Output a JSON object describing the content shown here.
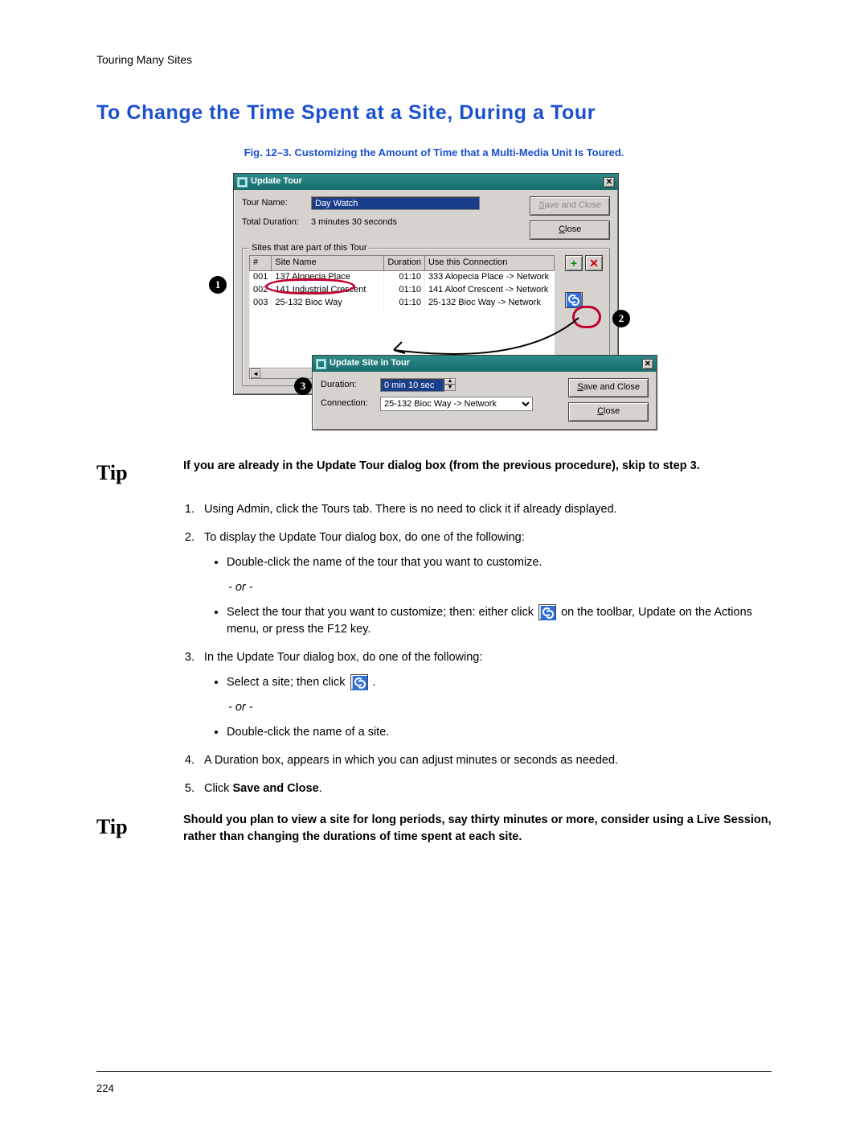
{
  "running_head": "Touring Many Sites",
  "heading": "To Change the Time Spent at a Site, During a Tour",
  "fig_caption": "Fig. 12–3.   Customizing the Amount of Time that a Multi-Media Unit Is Toured.",
  "update_tour": {
    "title": "Update Tour",
    "tour_name_label": "Tour Name:",
    "tour_name_value": "Day Watch",
    "total_duration_label": "Total Duration:",
    "total_duration_value": "3 minutes 30 seconds",
    "save_close": "Save and Close",
    "close": "Close",
    "group_label": "Sites that are part of this Tour",
    "columns": {
      "num": "#",
      "site": "Site Name",
      "dur": "Duration",
      "conn": "Use this Connection"
    },
    "rows": [
      {
        "num": "001",
        "site": "137 Alopecia Place",
        "dur": "01:10",
        "conn": "333 Alopecia Place -> Network"
      },
      {
        "num": "002",
        "site": "141 Industrial Crescent",
        "dur": "01:10",
        "conn": "141 Aloof Crescent -> Network"
      },
      {
        "num": "003",
        "site": "25-132 Bioc Way",
        "dur": "01:10",
        "conn": "25-132 Bioc Way -> Network"
      }
    ]
  },
  "update_site": {
    "title": "Update Site in Tour",
    "duration_label": "Duration:",
    "duration_value": "0 min 10 sec",
    "connection_label": "Connection:",
    "connection_value": "25-132 Bioc Way -> Network",
    "save_close": "Save and Close",
    "close": "Close"
  },
  "annotations": {
    "n1": "1",
    "n2": "2",
    "n3": "3"
  },
  "tip1_label": "Tip",
  "tip1_text": "If you are already in the Update Tour dialog box (from the previous procedure), skip to step 3.",
  "steps": {
    "s1": "Using Admin, click the Tours tab. There is no need to click it if already displayed.",
    "s2": "To display the Update Tour dialog box, do one of the following:",
    "s2a": "Double-click the name of the tour that you want to customize.",
    "or": "- or -",
    "s2b_pre": "Select the tour that you want to customize; then: either click ",
    "s2b_post": " on the toolbar, Update on the Actions menu, or press the F12 key.",
    "s3": "In the Update Tour dialog box, do one of the following:",
    "s3a_pre": "Select a site; then click ",
    "s3a_post": ".",
    "s3b": "Double-click the name of a site.",
    "s4": "A Duration box, appears in which you can adjust minutes or seconds as needed.",
    "s5_pre": "Click ",
    "s5_bold": "Save and Close",
    "s5_post": "."
  },
  "tip2_label": "Tip",
  "tip2_text": "Should you plan to view a site for long periods, say thirty minutes or more, consider using a Live Session, rather than changing the durations of time spent at each site.",
  "page_number": "224"
}
